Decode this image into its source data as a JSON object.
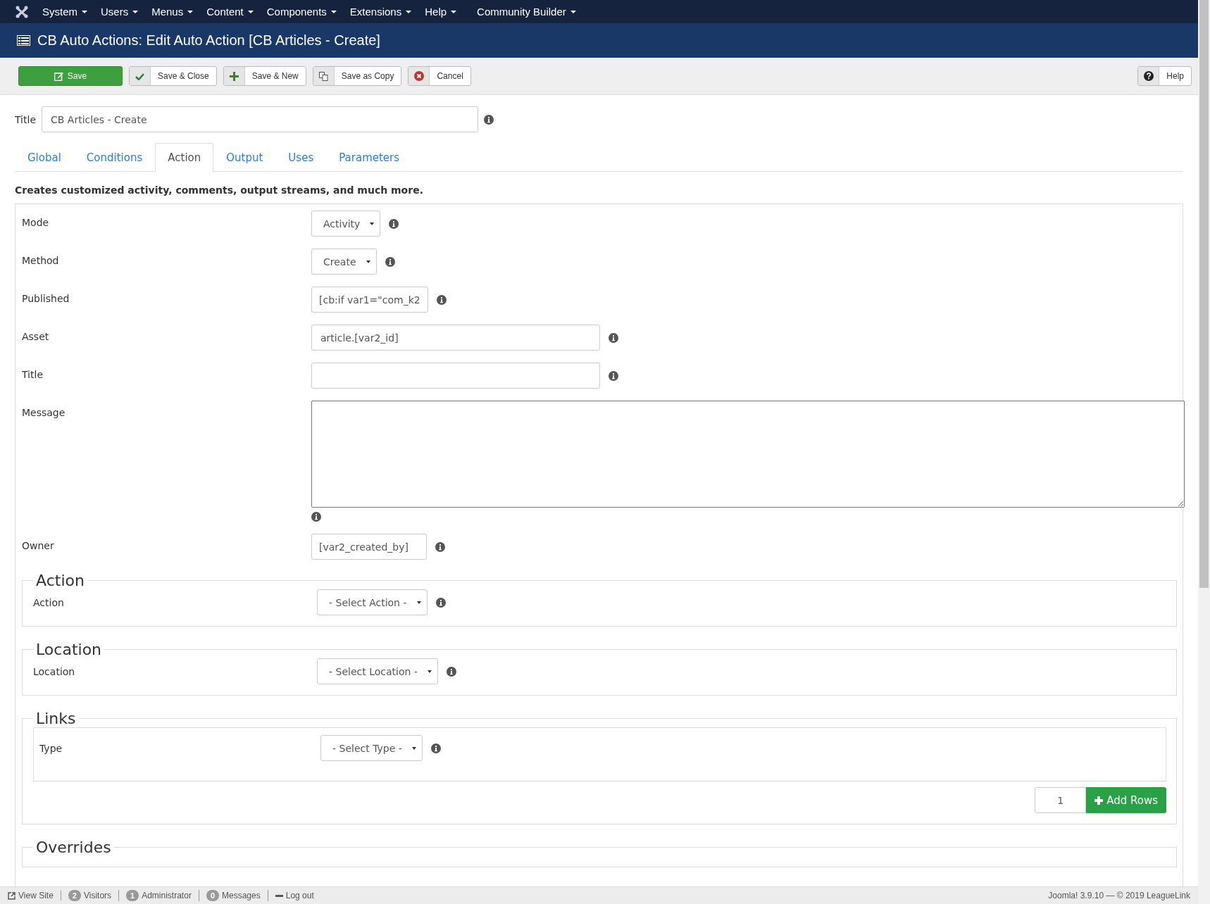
{
  "nav": {
    "menus": [
      {
        "label": "System"
      },
      {
        "label": "Users"
      },
      {
        "label": "Menus"
      },
      {
        "label": "Content"
      },
      {
        "label": "Components"
      },
      {
        "label": "Extensions"
      },
      {
        "label": "Help"
      },
      {
        "label": "Community Builder"
      }
    ]
  },
  "header": {
    "title": "CB Auto Actions: Edit Auto Action [CB Articles - Create]"
  },
  "toolbar": {
    "buttons": [
      {
        "label": "Save",
        "kind": "primary"
      },
      {
        "label": "Save & Close",
        "kind": "default"
      },
      {
        "label": "Save & New",
        "kind": "default"
      },
      {
        "label": "Save as Copy",
        "kind": "default"
      },
      {
        "label": "Cancel",
        "kind": "default"
      }
    ],
    "help": {
      "label": "Help"
    }
  },
  "title_field": {
    "label": "Title",
    "value": "CB Articles - Create"
  },
  "tabs": [
    {
      "label": "Global",
      "selected": false
    },
    {
      "label": "Conditions",
      "selected": false
    },
    {
      "label": "Action",
      "selected": true
    },
    {
      "label": "Output",
      "selected": false
    },
    {
      "label": "Uses",
      "selected": false
    },
    {
      "label": "Parameters",
      "selected": false
    }
  ],
  "description": "Creates customized activity, comments, output streams, and much more.",
  "fields": [
    {
      "label": "Mode",
      "kind": "select",
      "value": "Activity"
    },
    {
      "label": "Method",
      "kind": "select",
      "value": "Create"
    },
    {
      "label": "Published",
      "kind": "short",
      "value": "[cb:if var1=\"com_k2"
    },
    {
      "label": "Asset",
      "kind": "text",
      "value": "article.[var2_id]"
    },
    {
      "label": "Title",
      "kind": "text"
    },
    {
      "label": "Message",
      "kind": "textarea"
    },
    {
      "label": "Owner",
      "kind": "short",
      "value": "[var2_created_by]"
    }
  ],
  "fieldsets": [
    {
      "legend": "Action",
      "fields": [
        {
          "label": "Action",
          "kind": "select",
          "value": "- Select Action -"
        }
      ]
    },
    {
      "legend": "Location",
      "fields": [
        {
          "label": "Location",
          "kind": "select",
          "value": "- Select Location -"
        }
      ]
    },
    {
      "legend": "Links",
      "rows": [
        {
          "label": "Type",
          "kind": "select",
          "value": "- Select Type -"
        }
      ],
      "add_rows": {
        "count": "1",
        "label": "Add Rows"
      }
    },
    {
      "legend": "Overrides"
    }
  ],
  "status_bar": {
    "items": [
      {
        "kind": "link",
        "label": "View Site"
      },
      {
        "kind": "count",
        "count": "2",
        "label": "Visitors"
      },
      {
        "kind": "count",
        "count": "1",
        "label": "Administrator"
      },
      {
        "kind": "count",
        "count": "0",
        "label": "Messages"
      },
      {
        "kind": "logout",
        "label": "Log out"
      }
    ],
    "copyright": "Joomla! 3.9.10 — © 2019 LeagueLink"
  }
}
